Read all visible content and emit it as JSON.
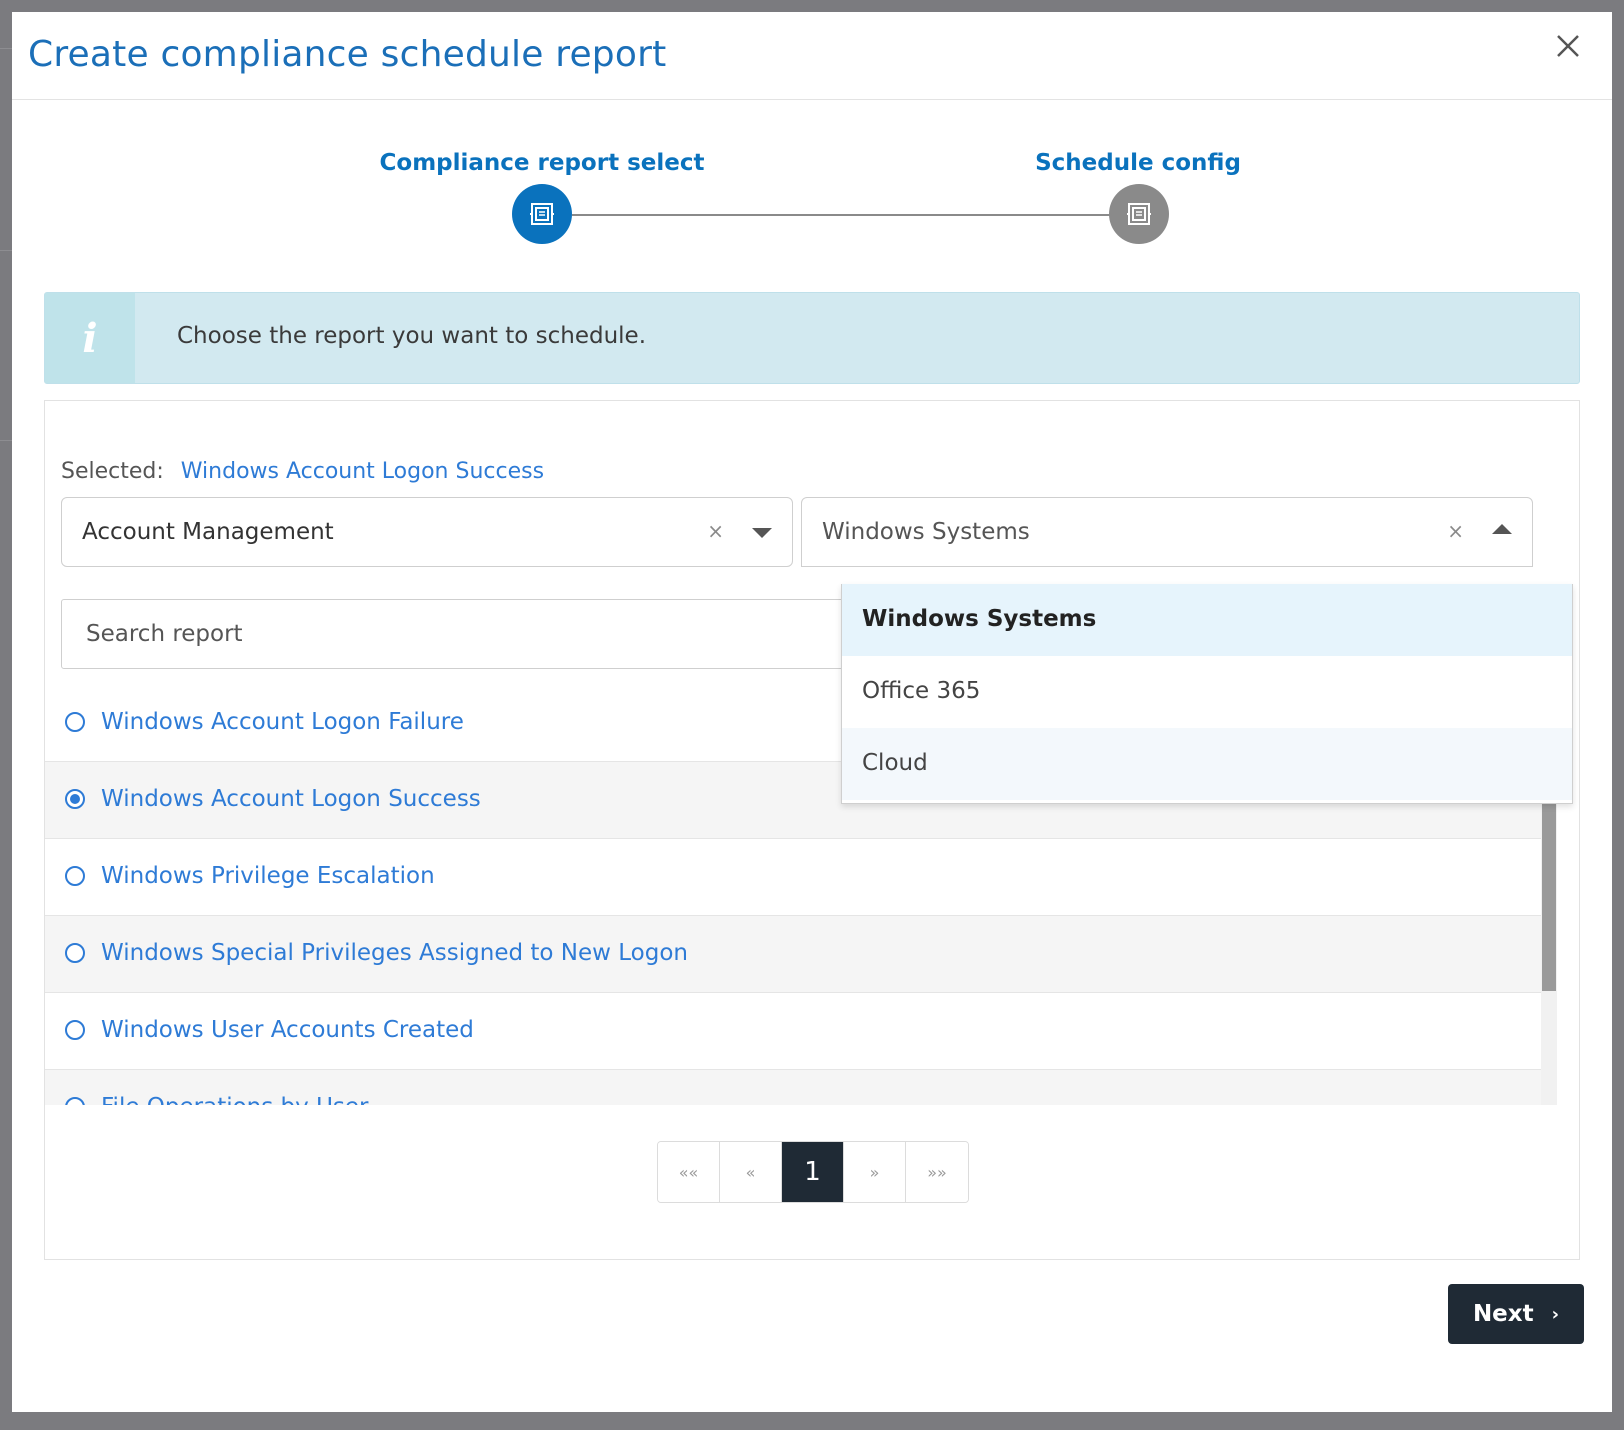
{
  "modal": {
    "title": "Create compliance schedule report"
  },
  "stepper": {
    "steps": [
      {
        "label": "Compliance report select",
        "state": "active",
        "color": "#0a72bd"
      },
      {
        "label": "Schedule config",
        "state": "inactive",
        "color": "#8a8a8a"
      }
    ]
  },
  "info": {
    "icon": "info-icon",
    "text": "Choose the report you want to schedule."
  },
  "selection": {
    "label": "Selected:",
    "value": "Windows Account Logon Success"
  },
  "category_select": {
    "value": "Account Management",
    "clear": "×"
  },
  "platform_select": {
    "value": "Windows Systems",
    "clear": "×",
    "open": true,
    "options": [
      "Windows Systems",
      "Office 365",
      "Cloud"
    ],
    "selected_option": "Windows Systems"
  },
  "search": {
    "placeholder": "Search report"
  },
  "reports": [
    {
      "label": "Windows Account Logon Failure",
      "checked": false
    },
    {
      "label": "Windows Account Logon Success",
      "checked": true
    },
    {
      "label": "Windows Privilege Escalation",
      "checked": false
    },
    {
      "label": "Windows Special Privileges Assigned to New Logon",
      "checked": false
    },
    {
      "label": "Windows User Accounts Created",
      "checked": false
    },
    {
      "label": "File Operations by User",
      "checked": false
    }
  ],
  "pagination": {
    "first": "««",
    "prev": "«",
    "current": "1",
    "next": "»",
    "last": "»»"
  },
  "footer": {
    "next_label": "Next",
    "next_icon": "›"
  },
  "colors": {
    "accent": "#0a72bd",
    "link": "#2e7bd6",
    "dark_button": "#1f2a35",
    "info_bg": "#d2e9f0"
  }
}
